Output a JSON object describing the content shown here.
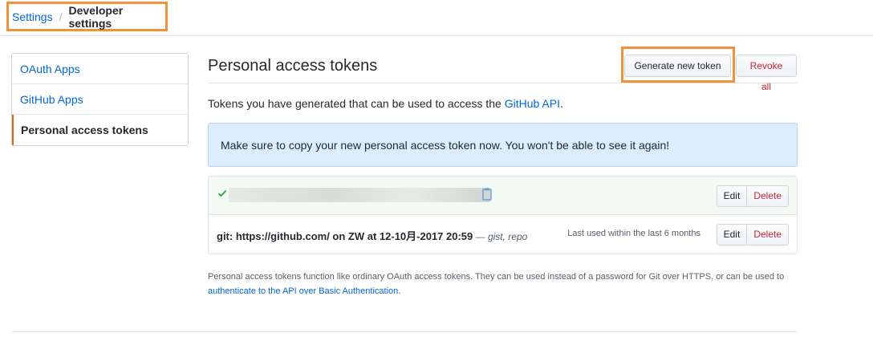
{
  "breadcrumb": {
    "parent": "Settings",
    "separator": "/",
    "current": "Developer settings"
  },
  "sidebar": {
    "items": [
      {
        "label": "OAuth Apps"
      },
      {
        "label": "GitHub Apps"
      },
      {
        "label": "Personal access tokens"
      }
    ]
  },
  "main": {
    "title": "Personal access tokens",
    "generate_label": "Generate new token",
    "revoke_label": "Revoke all",
    "intro_text": "Tokens you have generated that can be used to access the ",
    "intro_link": "GitHub API",
    "intro_end": ".",
    "flash_message": "Make sure to copy your new personal access token now. You won't be able to see it again!",
    "tokens": [
      {
        "edit_label": "Edit",
        "delete_label": "Delete"
      },
      {
        "description": "git: https://github.com/ on ZW at 12-10月-2017 20:59",
        "dash": " — ",
        "scopes": "gist, repo",
        "last_used": "Last used within the last 6 months",
        "edit_label": "Edit",
        "delete_label": "Delete"
      }
    ],
    "note_text": "Personal access tokens function like ordinary OAuth access tokens. They can be used instead of a password for Git over HTTPS, or can be used to ",
    "note_link": "authenticate to the API over Basic Authentication",
    "note_end": "."
  },
  "colors": {
    "link": "#0366d6",
    "highlight": "#f0923a",
    "danger": "#cb2431",
    "flash_bg": "#dbedff",
    "success": "#28a745"
  },
  "icons": {
    "check": "check-icon",
    "copy": "clipboard-icon"
  }
}
